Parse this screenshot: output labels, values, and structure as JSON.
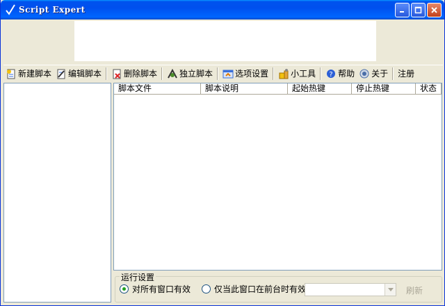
{
  "window": {
    "title": "Script Expert"
  },
  "toolbar": {
    "items": [
      {
        "label": "新建脚本",
        "icon": "new-script-icon"
      },
      {
        "label": "编辑脚本",
        "icon": "edit-script-icon"
      },
      {
        "label": "删除脚本",
        "icon": "delete-script-icon"
      },
      {
        "label": "独立脚本",
        "icon": "standalone-script-icon"
      },
      {
        "label": "选项设置",
        "icon": "options-icon"
      },
      {
        "label": "小工具",
        "icon": "tools-icon"
      },
      {
        "label": "帮助",
        "icon": "help-icon"
      },
      {
        "label": "关于",
        "icon": "about-icon"
      },
      {
        "label": "注册",
        "icon": ""
      }
    ]
  },
  "list": {
    "columns": [
      "脚本文件",
      "脚本说明",
      "起始热键",
      "停止热键",
      "状态"
    ]
  },
  "settings": {
    "legend": "运行设置",
    "option_all": "对所有窗口有效",
    "option_foreground": "仅当此窗口在前台时有效",
    "selected": "option_all",
    "combo_value": "",
    "refresh_label": "刷新"
  },
  "colors": {
    "titlebar": "#0050ee",
    "face": "#ece9d8",
    "border": "#7f9db9"
  }
}
